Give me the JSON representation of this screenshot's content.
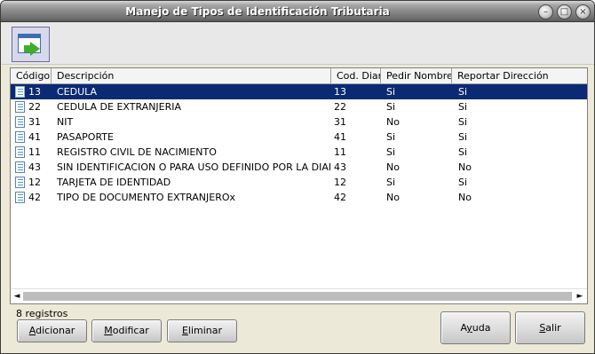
{
  "window": {
    "title": "Manejo de Tipos de Identificación Tributaria",
    "controls": {
      "minimize": "–",
      "maximize": "□",
      "close": "×"
    }
  },
  "toolbar": {
    "icon": "window-go-icon"
  },
  "table": {
    "columns": [
      "Código",
      "Descripción",
      "Cod. Dian",
      "Pedir Nombres",
      "Reportar Dirección"
    ],
    "selected_index": 0,
    "rows": [
      {
        "codigo": "13",
        "descripcion": "CEDULA",
        "cod_dian": "13",
        "pedir_nombres": "Si",
        "reportar_direccion": "Si"
      },
      {
        "codigo": "22",
        "descripcion": "CEDULA DE EXTRANJERIA",
        "cod_dian": "22",
        "pedir_nombres": "Si",
        "reportar_direccion": "Si"
      },
      {
        "codigo": "31",
        "descripcion": "NIT",
        "cod_dian": "31",
        "pedir_nombres": "No",
        "reportar_direccion": "Si"
      },
      {
        "codigo": "41",
        "descripcion": "PASAPORTE",
        "cod_dian": "41",
        "pedir_nombres": "Si",
        "reportar_direccion": "Si"
      },
      {
        "codigo": "11",
        "descripcion": "REGISTRO CIVIL DE NACIMIENTO",
        "cod_dian": "11",
        "pedir_nombres": "Si",
        "reportar_direccion": "Si"
      },
      {
        "codigo": "43",
        "descripcion": "SIN IDENTIFICACION O PARA USO DEFINIDO POR LA DIAN",
        "cod_dian": "43",
        "pedir_nombres": "No",
        "reportar_direccion": "No"
      },
      {
        "codigo": "12",
        "descripcion": "TARJETA DE IDENTIDAD",
        "cod_dian": "12",
        "pedir_nombres": "Si",
        "reportar_direccion": "Si"
      },
      {
        "codigo": "42",
        "descripcion": "TIPO DE DOCUMENTO EXTRANJEROx",
        "cod_dian": "42",
        "pedir_nombres": "No",
        "reportar_direccion": "No"
      }
    ]
  },
  "scrollbar": {
    "left_arrow": "◄",
    "right_arrow": "►"
  },
  "status": {
    "count": "8 registros"
  },
  "buttons": {
    "adicionar": {
      "mnemonic": "A",
      "rest": "dicionar"
    },
    "modificar": {
      "mnemonic": "M",
      "rest": "odificar"
    },
    "eliminar": {
      "mnemonic": "E",
      "rest": "liminar"
    },
    "ayuda": {
      "pre": "A",
      "mnemonic": "y",
      "rest": "uda"
    },
    "salir": {
      "mnemonic": "S",
      "rest": "alir"
    }
  },
  "colors": {
    "selection": "#0b2a73",
    "accent_green": "#3fae2a"
  }
}
